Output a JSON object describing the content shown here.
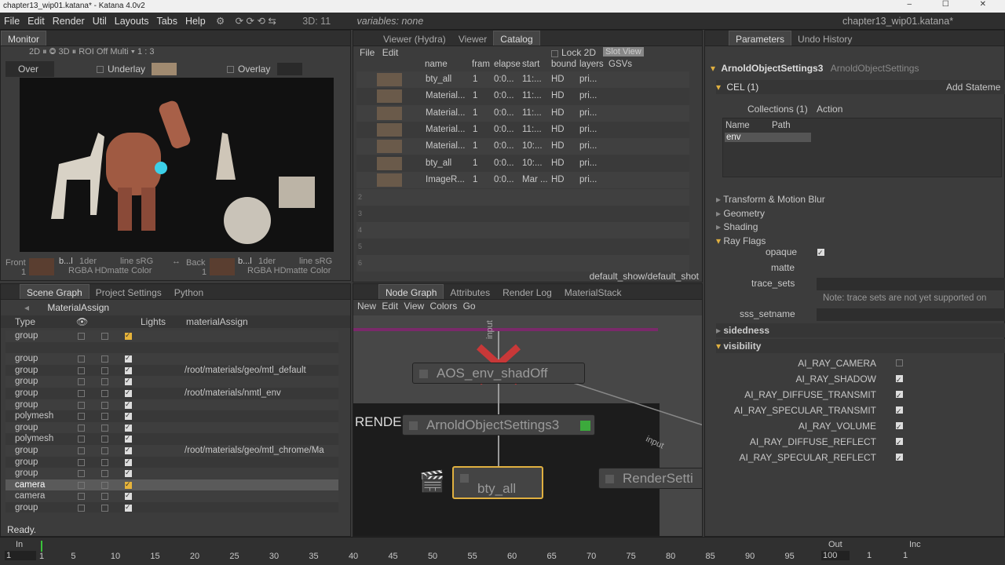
{
  "window": {
    "title": "chapter13_wip01.katana* - Katana 4.0v2",
    "controls": "– ☐ ✕"
  },
  "menubar": {
    "items": [
      "File",
      "Edit",
      "Render",
      "Util",
      "Layouts",
      "Tabs",
      "Help"
    ],
    "counter": "3D: 11",
    "variables": "variables: none",
    "project": "chapter13_wip01.katana*"
  },
  "monitor": {
    "tab": "Monitor",
    "toolbar": "2D ⏸ ◎   3D ⏸    ROI Off   Multi ▾  1 : 3",
    "over": "Over",
    "underlay": "Underlay",
    "overlay": "Overlay",
    "front": "Front",
    "front_num": "1",
    "front_info1": "b...l",
    "front_info2": "1der",
    "front_info3": "line sRG",
    "front_info4": "RGBA HDmatte Color",
    "back": "Back",
    "back_num": "1",
    "back_info1": "b...l",
    "back_info2": "1der",
    "back_info3": "line sRG",
    "back_info4": "RGBA HDmatte Color"
  },
  "catalog": {
    "tabs": [
      "Viewer (Hydra)",
      "Viewer",
      "Catalog"
    ],
    "menu": [
      "File",
      "Edit"
    ],
    "lock": "Lock 2D",
    "slot_view": "Slot View",
    "headers": [
      "name",
      "fram",
      "elapse",
      "start",
      "bound",
      "layers",
      "GSVs"
    ],
    "rows": [
      {
        "name": "bty_all",
        "frame": "1",
        "elapsed": "0:0...",
        "start": "11:...",
        "bound": "HD",
        "layers": "pri..."
      },
      {
        "name": "Material...",
        "frame": "1",
        "elapsed": "0:0...",
        "start": "11:...",
        "bound": "HD",
        "layers": "pri..."
      },
      {
        "name": "Material...",
        "frame": "1",
        "elapsed": "0:0...",
        "start": "11:...",
        "bound": "HD",
        "layers": "pri..."
      },
      {
        "name": "Material...",
        "frame": "1",
        "elapsed": "0:0...",
        "start": "11:...",
        "bound": "HD",
        "layers": "pri..."
      },
      {
        "name": "Material...",
        "frame": "1",
        "elapsed": "0:0...",
        "start": "10:...",
        "bound": "HD",
        "layers": "pri..."
      },
      {
        "name": "bty_all",
        "frame": "1",
        "elapsed": "0:0...",
        "start": "10:...",
        "bound": "HD",
        "layers": "pri..."
      },
      {
        "name": "ImageR...",
        "frame": "1",
        "elapsed": "0:0...",
        "start": "Mar ...",
        "bound": "HD",
        "layers": "pri..."
      }
    ],
    "empty_rows": [
      "2",
      "3",
      "4",
      "5",
      "6"
    ],
    "footer": "default_show/default_shot"
  },
  "scenegraph": {
    "tabs": [
      "Scene Graph",
      "Project Settings",
      "Python"
    ],
    "node": "MaterialAssign",
    "headers": {
      "type": "Type",
      "lights": "Lights",
      "material": "materialAssign"
    },
    "rows": [
      {
        "type": "group",
        "mat": ""
      },
      {
        "type": "",
        "mat": ""
      },
      {
        "type": "group",
        "mat": ""
      },
      {
        "type": "group",
        "mat": "/root/materials/geo/mtl_default"
      },
      {
        "type": "group",
        "mat": ""
      },
      {
        "type": "group",
        "mat": "/root/materials/nmtl_env"
      },
      {
        "type": "group",
        "mat": ""
      },
      {
        "type": "polymesh",
        "mat": ""
      },
      {
        "type": "group",
        "mat": ""
      },
      {
        "type": "polymesh",
        "mat": ""
      },
      {
        "type": "group",
        "mat": "/root/materials/geo/mtl_chrome/Ma"
      },
      {
        "type": "group",
        "mat": ""
      },
      {
        "type": "group",
        "mat": ""
      },
      {
        "type": "camera",
        "mat": ""
      },
      {
        "type": "camera",
        "mat": ""
      },
      {
        "type": "group",
        "mat": ""
      }
    ],
    "status": "Ready."
  },
  "nodegraph": {
    "tabs": [
      "Node Graph",
      "Attributes",
      "Render Log",
      "MaterialStack"
    ],
    "menu": [
      "New",
      "Edit",
      "View",
      "Colors",
      "Go"
    ],
    "input_label": "input",
    "input_label2": "input",
    "backdrop": "RENDER",
    "nodes": {
      "aos": "AOS_env_shadOff",
      "arnold": "ArnoldObjectSettings3",
      "bty": "bty_all",
      "render": "RenderSetti"
    }
  },
  "params": {
    "tabs": [
      "Parameters",
      "Undo History"
    ],
    "node_name": "ArnoldObjectSettings3",
    "node_type": "ArnoldObjectSettings",
    "cel": "CEL (1)",
    "add_statement": "Add Stateme",
    "collections": "Collections (1)",
    "action": "Action",
    "col_name": "Name",
    "col_path": "Path",
    "env": "env",
    "groups": [
      "Transform & Motion Blur",
      "Geometry",
      "Shading",
      "Ray Flags"
    ],
    "flags": [
      "opaque",
      "matte",
      "trace_sets"
    ],
    "note": "Note: trace sets are not yet supported on",
    "sss": "sss_setname",
    "sidedness": "sidedness",
    "visibility": "visibility",
    "vis_items": [
      "AI_RAY_CAMERA",
      "AI_RAY_SHADOW",
      "AI_RAY_DIFFUSE_TRANSMIT",
      "AI_RAY_SPECULAR_TRANSMIT",
      "AI_RAY_VOLUME",
      "AI_RAY_DIFFUSE_REFLECT",
      "AI_RAY_SPECULAR_REFLECT"
    ]
  },
  "timeline": {
    "in": "In",
    "in_val": "1",
    "out": "Out",
    "out_val": "100",
    "cur": "1",
    "inc": "Inc",
    "inc_val": "1",
    "ticks": [
      "1",
      "5",
      "10",
      "15",
      "20",
      "25",
      "30",
      "35",
      "40",
      "45",
      "50",
      "55",
      "60",
      "65",
      "70",
      "75",
      "80",
      "85",
      "90",
      "95",
      "100"
    ]
  }
}
